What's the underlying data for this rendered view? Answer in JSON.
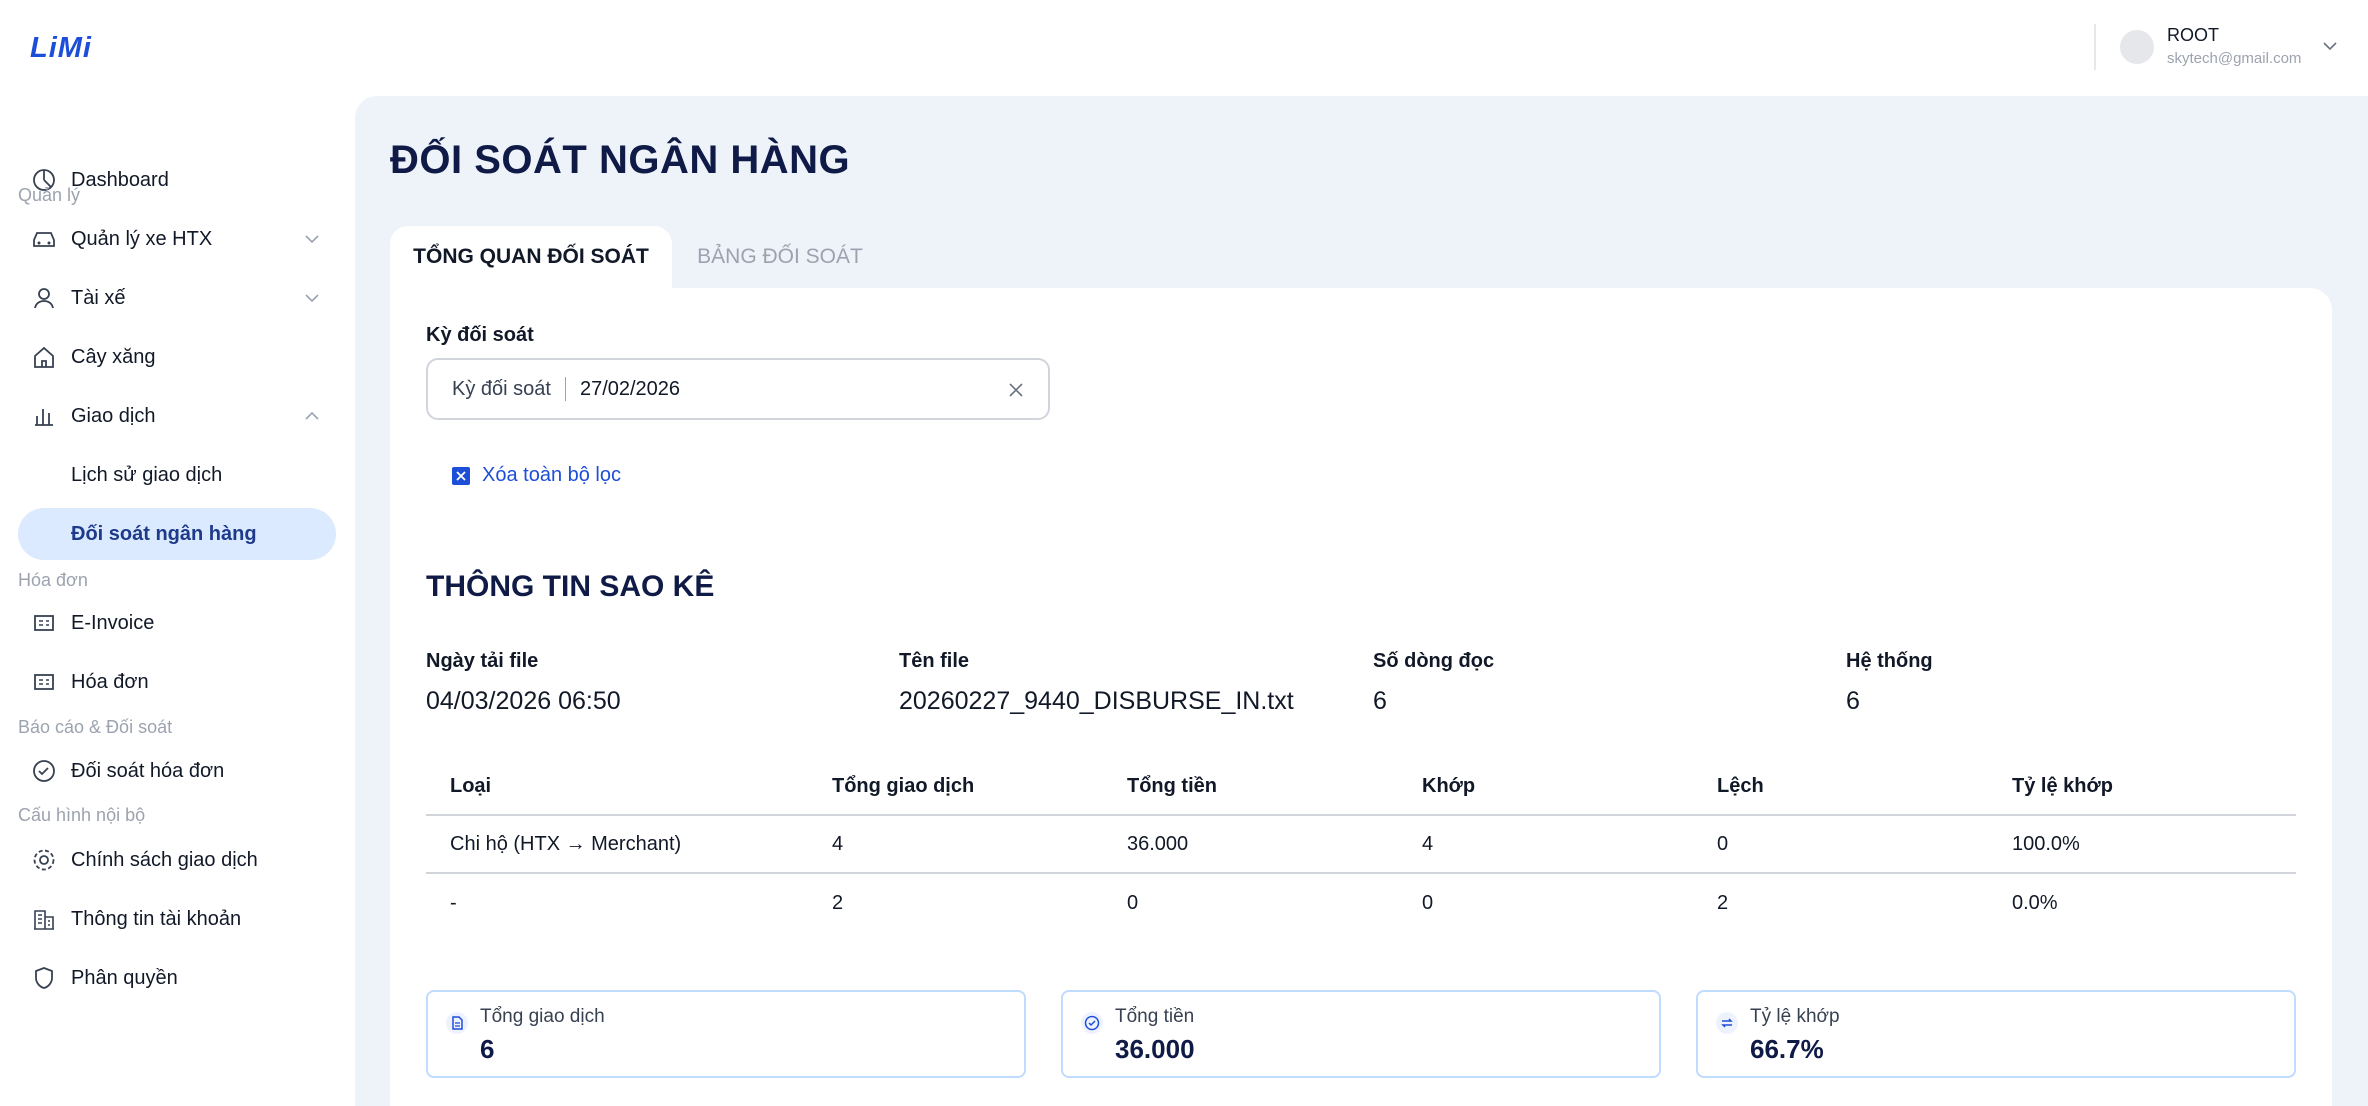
{
  "header": {
    "logo": "LiMi",
    "user": {
      "name": "ROOT",
      "email": "skytech@gmail.com"
    }
  },
  "sidebar": {
    "dashboard": "Dashboard",
    "sections": {
      "quan_ly": "Quản lý",
      "hoa_don": "Hóa đơn",
      "bao_cao": "Báo cáo & Đối soát",
      "cau_hinh": "Cấu hình nội bộ"
    },
    "items": {
      "quan_ly_xe": "Quản lý xe HTX",
      "tai_xe": "Tài xế",
      "cay_xang": "Cây xăng",
      "giao_dich": "Giao dịch",
      "lich_su": "Lịch sử giao dịch",
      "doi_soat_ngan_hang": "Đối soát ngân hàng",
      "einvoice": "E-Invoice",
      "hoa_don": "Hóa đơn",
      "doi_soat_hoa_don": "Đối soát hóa đơn",
      "chinh_sach": "Chính sách giao dịch",
      "thong_tin_tai_khoan": "Thông tin tài khoản",
      "phan_quyen": "Phân quyền"
    }
  },
  "main": {
    "title": "ĐỐI SOÁT NGÂN HÀNG",
    "tabs": {
      "overview": "TỔNG QUAN ĐỐI SOÁT",
      "table": "BẢNG ĐỐI SOÁT"
    },
    "filter": {
      "label": "Kỳ đối soát",
      "field_label": "Kỳ đối soát",
      "value": "27/02/2026",
      "clear_all": "Xóa toàn bộ lọc"
    },
    "statement": {
      "title": "THÔNG TIN SAO KÊ",
      "upload_date": {
        "label": "Ngày tải file",
        "value": "04/03/2026 06:50"
      },
      "file_name": {
        "label": "Tên file",
        "value": "20260227_9440_DISBURSE_IN.txt"
      },
      "rows_read": {
        "label": "Số dòng đọc",
        "value": "6"
      },
      "system": {
        "label": "Hệ thống",
        "value": "6"
      }
    },
    "table": {
      "headers": [
        "Loại",
        "Tổng giao dịch",
        "Tổng tiền",
        "Khớp",
        "Lệch",
        "Tỷ lệ khớp"
      ],
      "rows": [
        [
          "Chi hộ (HTX → Merchant)",
          "4",
          "36.000",
          "4",
          "0",
          "100.0%"
        ],
        [
          "-",
          "2",
          "0",
          "0",
          "2",
          "0.0%"
        ]
      ]
    },
    "stats": [
      {
        "label": "Tổng giao dịch",
        "value": "6",
        "icon": "document-icon"
      },
      {
        "label": "Tổng tiền",
        "value": "36.000",
        "icon": "check-circle-icon"
      },
      {
        "label": "Tỷ lệ khớp",
        "value": "66.7%",
        "icon": "refresh-icon"
      }
    ]
  }
}
